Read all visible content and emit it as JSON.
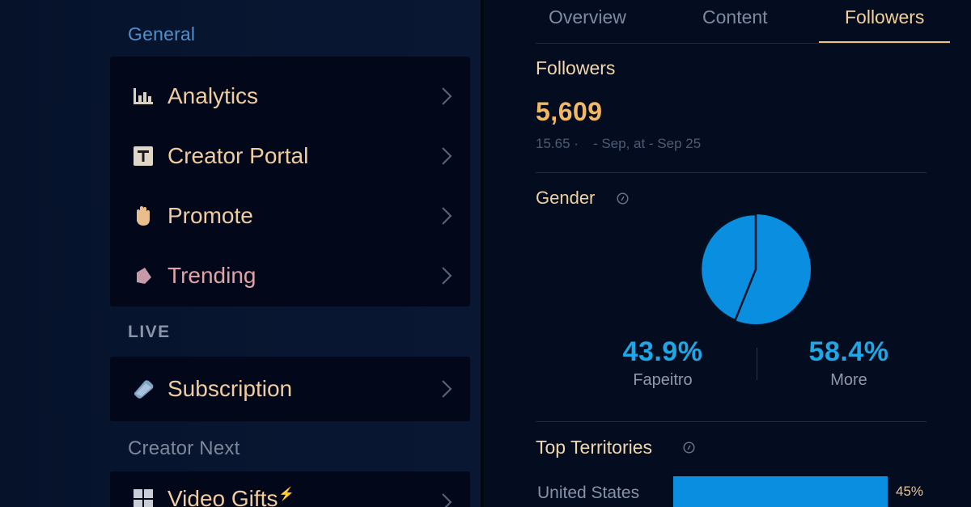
{
  "sidebar": {
    "section_general": "General",
    "section_live": "LIVE",
    "section_next": "Creator Next",
    "items": [
      {
        "label": "Analytics",
        "icon": "chart-icon"
      },
      {
        "label": "Creator Portal",
        "icon": "portal-icon"
      },
      {
        "label": "Promote",
        "icon": "hand-icon"
      },
      {
        "label": "Trending",
        "icon": "tag-icon"
      },
      {
        "label": "Subscription",
        "icon": "gem-icon"
      },
      {
        "label": "Video Gifts",
        "icon": "grid-icon"
      }
    ]
  },
  "tabs": [
    "Overview",
    "Content",
    "Followers"
  ],
  "active_tab": "Followers",
  "followers": {
    "title": "Followers",
    "count": "5,609",
    "sub_a": "15.65 ·",
    "sub_b": "- Sep, at - Sep 25"
  },
  "gender": {
    "title": "Gender",
    "left_value": "43.9%",
    "left_label": "Fapeitro",
    "right_value": "58.4%",
    "right_label": "More",
    "pie_fraction_minor": 0.439
  },
  "territories": {
    "title": "Top Territories",
    "rows": [
      {
        "name": "United States",
        "pct": "45%",
        "fraction": 0.45
      }
    ]
  },
  "colors": {
    "accent": "#f2b863",
    "blue": "#1da7e6",
    "bar": "#0a8fe0"
  }
}
